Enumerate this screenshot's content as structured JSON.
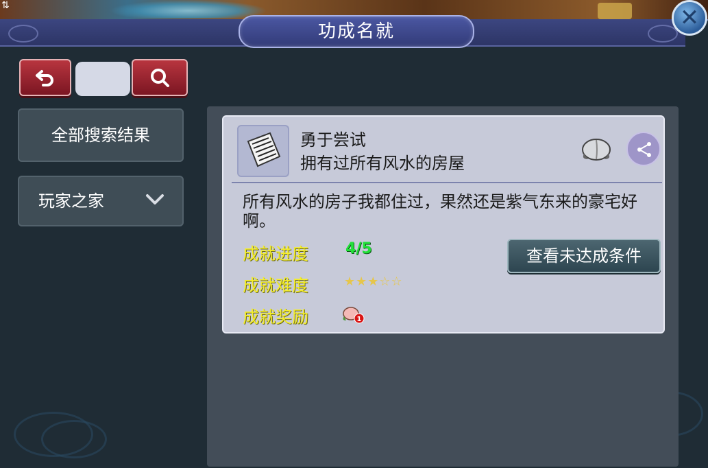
{
  "window": {
    "title": "功成名就",
    "close_label": "✕"
  },
  "toolbar": {
    "back_icon": "undo-arrow-icon",
    "search_icon": "magnifier-icon",
    "search_value": ""
  },
  "sidebar": {
    "items": [
      {
        "label": "全部搜索结果"
      },
      {
        "label": "玩家之家",
        "has_dropdown": true
      }
    ]
  },
  "achievement": {
    "name": "勇于尝试",
    "subtitle": "拥有过所有风水的房屋",
    "description": "所有风水的房子我都住过，果然还是紫气东来的豪宅好啊。",
    "progress_label": "成就进度",
    "progress_value": "4/5",
    "difficulty_label": "成就难度",
    "difficulty_stars": "★★★☆☆",
    "reward_label": "成就奖励",
    "reward_count": "1",
    "condition_button": "查看未达成条件"
  },
  "colors": {
    "label_yellow": "#f5ee2b",
    "progress_green": "#23e03a",
    "panel_bg": "#1f2c35",
    "card_bg": "#c7cad9"
  }
}
